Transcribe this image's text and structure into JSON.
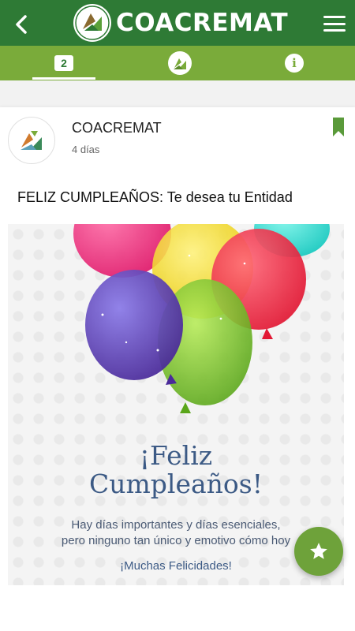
{
  "header": {
    "brand": "COACREMAT",
    "back_icon": "chevron-left-icon",
    "menu_icon": "hamburger-menu-icon"
  },
  "tabs": {
    "count_badge": "2",
    "logo_icon": "recycle-logo-icon",
    "info_label": "i"
  },
  "post": {
    "author": "COACREMAT",
    "time": "4 días",
    "title": "FELIZ CUMPLEAÑOS: Te desea tu Entidad",
    "image": {
      "greeting_line1": "¡Feliz",
      "greeting_line2": "Cumpleaños!",
      "message_line1": "Hay días importantes y días esenciales,",
      "message_line2": "pero ninguno tan único y emotivo cómo hoy",
      "message_line3": "¡Muchas Felicidades!"
    }
  },
  "colors": {
    "header_green": "#2e7a35",
    "tab_green": "#7aab3a",
    "fab_green": "#6ea23a"
  }
}
